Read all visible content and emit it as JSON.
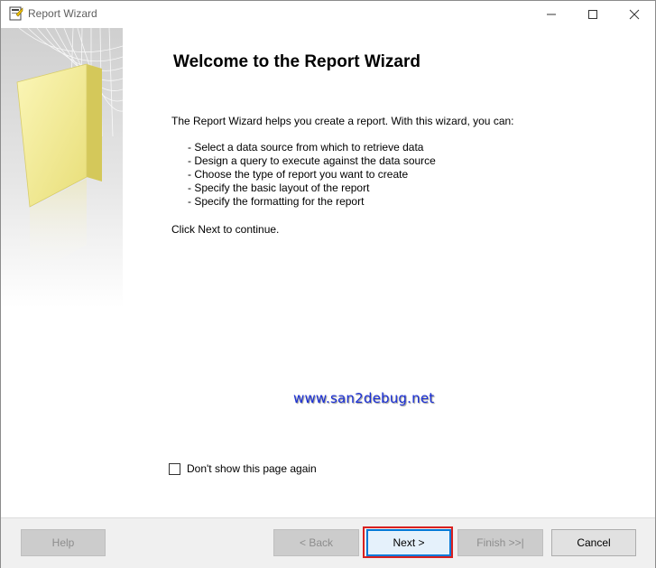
{
  "window": {
    "title": "Report Wizard"
  },
  "page": {
    "heading": "Welcome to the Report Wizard",
    "intro": "The Report Wizard helps you create a report. With this wizard, you can:",
    "bullets": [
      "- Select a data source from which to retrieve data",
      "- Design a query to execute against the data source",
      "- Choose the type of report you want to create",
      "- Specify the basic layout of the report",
      "- Specify the formatting for the report"
    ],
    "click_next": "Click Next to continue.",
    "watermark": "www.san2debug.net",
    "dont_show_label": "Don't show this page again",
    "dont_show_checked": false
  },
  "buttons": {
    "help": "Help",
    "back": "< Back",
    "next": "Next >",
    "finish": "Finish >>|",
    "cancel": "Cancel"
  },
  "colors": {
    "highlight": "#d9201f",
    "default_button_border": "#0078d7",
    "watermark": "#1a2fd6"
  }
}
